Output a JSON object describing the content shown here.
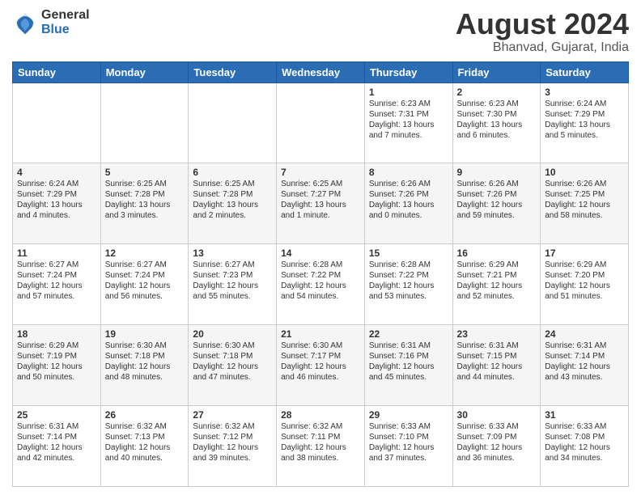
{
  "logo": {
    "general": "General",
    "blue": "Blue"
  },
  "title": "August 2024",
  "location": "Bhanvad, Gujarat, India",
  "days": [
    "Sunday",
    "Monday",
    "Tuesday",
    "Wednesday",
    "Thursday",
    "Friday",
    "Saturday"
  ],
  "weeks": [
    [
      {
        "day": "",
        "info": ""
      },
      {
        "day": "",
        "info": ""
      },
      {
        "day": "",
        "info": ""
      },
      {
        "day": "",
        "info": ""
      },
      {
        "day": "1",
        "info": "Sunrise: 6:23 AM\nSunset: 7:31 PM\nDaylight: 13 hours\nand 7 minutes."
      },
      {
        "day": "2",
        "info": "Sunrise: 6:23 AM\nSunset: 7:30 PM\nDaylight: 13 hours\nand 6 minutes."
      },
      {
        "day": "3",
        "info": "Sunrise: 6:24 AM\nSunset: 7:29 PM\nDaylight: 13 hours\nand 5 minutes."
      }
    ],
    [
      {
        "day": "4",
        "info": "Sunrise: 6:24 AM\nSunset: 7:29 PM\nDaylight: 13 hours\nand 4 minutes."
      },
      {
        "day": "5",
        "info": "Sunrise: 6:25 AM\nSunset: 7:28 PM\nDaylight: 13 hours\nand 3 minutes."
      },
      {
        "day": "6",
        "info": "Sunrise: 6:25 AM\nSunset: 7:28 PM\nDaylight: 13 hours\nand 2 minutes."
      },
      {
        "day": "7",
        "info": "Sunrise: 6:25 AM\nSunset: 7:27 PM\nDaylight: 13 hours\nand 1 minute."
      },
      {
        "day": "8",
        "info": "Sunrise: 6:26 AM\nSunset: 7:26 PM\nDaylight: 13 hours\nand 0 minutes."
      },
      {
        "day": "9",
        "info": "Sunrise: 6:26 AM\nSunset: 7:26 PM\nDaylight: 12 hours\nand 59 minutes."
      },
      {
        "day": "10",
        "info": "Sunrise: 6:26 AM\nSunset: 7:25 PM\nDaylight: 12 hours\nand 58 minutes."
      }
    ],
    [
      {
        "day": "11",
        "info": "Sunrise: 6:27 AM\nSunset: 7:24 PM\nDaylight: 12 hours\nand 57 minutes."
      },
      {
        "day": "12",
        "info": "Sunrise: 6:27 AM\nSunset: 7:24 PM\nDaylight: 12 hours\nand 56 minutes."
      },
      {
        "day": "13",
        "info": "Sunrise: 6:27 AM\nSunset: 7:23 PM\nDaylight: 12 hours\nand 55 minutes."
      },
      {
        "day": "14",
        "info": "Sunrise: 6:28 AM\nSunset: 7:22 PM\nDaylight: 12 hours\nand 54 minutes."
      },
      {
        "day": "15",
        "info": "Sunrise: 6:28 AM\nSunset: 7:22 PM\nDaylight: 12 hours\nand 53 minutes."
      },
      {
        "day": "16",
        "info": "Sunrise: 6:29 AM\nSunset: 7:21 PM\nDaylight: 12 hours\nand 52 minutes."
      },
      {
        "day": "17",
        "info": "Sunrise: 6:29 AM\nSunset: 7:20 PM\nDaylight: 12 hours\nand 51 minutes."
      }
    ],
    [
      {
        "day": "18",
        "info": "Sunrise: 6:29 AM\nSunset: 7:19 PM\nDaylight: 12 hours\nand 50 minutes."
      },
      {
        "day": "19",
        "info": "Sunrise: 6:30 AM\nSunset: 7:18 PM\nDaylight: 12 hours\nand 48 minutes."
      },
      {
        "day": "20",
        "info": "Sunrise: 6:30 AM\nSunset: 7:18 PM\nDaylight: 12 hours\nand 47 minutes."
      },
      {
        "day": "21",
        "info": "Sunrise: 6:30 AM\nSunset: 7:17 PM\nDaylight: 12 hours\nand 46 minutes."
      },
      {
        "day": "22",
        "info": "Sunrise: 6:31 AM\nSunset: 7:16 PM\nDaylight: 12 hours\nand 45 minutes."
      },
      {
        "day": "23",
        "info": "Sunrise: 6:31 AM\nSunset: 7:15 PM\nDaylight: 12 hours\nand 44 minutes."
      },
      {
        "day": "24",
        "info": "Sunrise: 6:31 AM\nSunset: 7:14 PM\nDaylight: 12 hours\nand 43 minutes."
      }
    ],
    [
      {
        "day": "25",
        "info": "Sunrise: 6:31 AM\nSunset: 7:14 PM\nDaylight: 12 hours\nand 42 minutes."
      },
      {
        "day": "26",
        "info": "Sunrise: 6:32 AM\nSunset: 7:13 PM\nDaylight: 12 hours\nand 40 minutes."
      },
      {
        "day": "27",
        "info": "Sunrise: 6:32 AM\nSunset: 7:12 PM\nDaylight: 12 hours\nand 39 minutes."
      },
      {
        "day": "28",
        "info": "Sunrise: 6:32 AM\nSunset: 7:11 PM\nDaylight: 12 hours\nand 38 minutes."
      },
      {
        "day": "29",
        "info": "Sunrise: 6:33 AM\nSunset: 7:10 PM\nDaylight: 12 hours\nand 37 minutes."
      },
      {
        "day": "30",
        "info": "Sunrise: 6:33 AM\nSunset: 7:09 PM\nDaylight: 12 hours\nand 36 minutes."
      },
      {
        "day": "31",
        "info": "Sunrise: 6:33 AM\nSunset: 7:08 PM\nDaylight: 12 hours\nand 34 minutes."
      }
    ]
  ]
}
